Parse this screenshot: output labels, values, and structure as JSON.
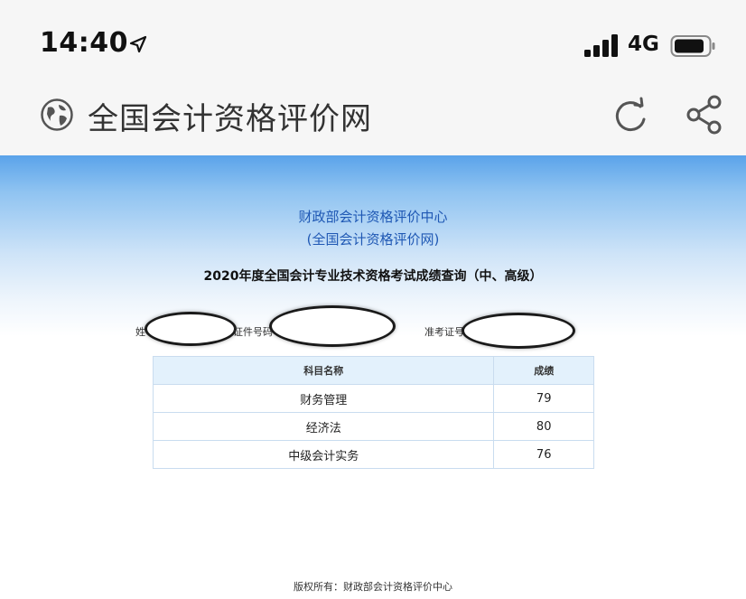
{
  "status_bar": {
    "time": "14:40",
    "network": "4G",
    "icons": [
      "location-arrow-icon",
      "signal-icon",
      "battery-icon"
    ]
  },
  "browser": {
    "title": "全国会计资格评价网",
    "icons": [
      "globe-icon",
      "reload-icon",
      "share-icon"
    ]
  },
  "header": {
    "org_name": "财政部会计资格评价中心",
    "org_sub": "(全国会计资格评价网)",
    "query_title": "2020年度全国会计专业技术资格考试成绩查询（中、高级）"
  },
  "info": {
    "name_label": "姓",
    "id_label": "证件号码",
    "ticket_label": "准考证号"
  },
  "table": {
    "headers": [
      "科目名称",
      "成绩"
    ],
    "rows": [
      {
        "subject": "财务管理",
        "score": "79"
      },
      {
        "subject": "经济法",
        "score": "80"
      },
      {
        "subject": "中级会计实务",
        "score": "76"
      }
    ]
  },
  "footer": {
    "copyright": "版权所有：财政部会计资格评价中心"
  },
  "colors": {
    "header_blue": "#1f58b4",
    "gradient_top": "#5aa3ea",
    "table_header_bg": "#e3f1fc",
    "table_border": "#c9dcef"
  }
}
